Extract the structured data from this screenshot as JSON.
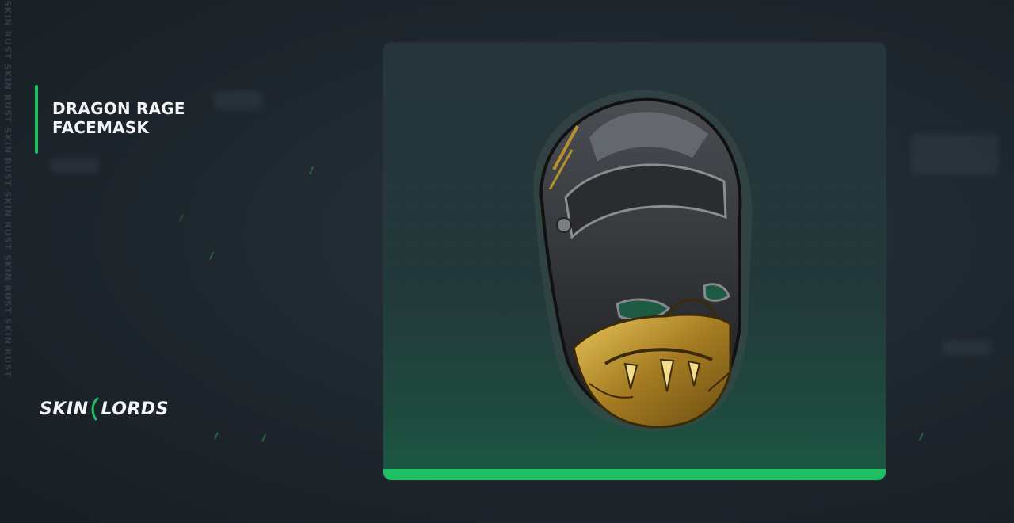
{
  "item": {
    "name_line1": "DRAGON RAGE",
    "name_line2": "FACEMASK",
    "image_icon": "dragon-rage-facemask-icon"
  },
  "brand": {
    "logo_left": "SKIN",
    "logo_right": "LORDS",
    "watermark": "SKIN RUST SKIN RUST SKIN RUST SKIN RUST SKIN RUST SKIN RUST"
  },
  "colors": {
    "accent": "#1fbf63",
    "background": "#1e262d",
    "card": "#23383a",
    "mask_gold": "#b8912e",
    "mask_black": "#2b2d30"
  }
}
